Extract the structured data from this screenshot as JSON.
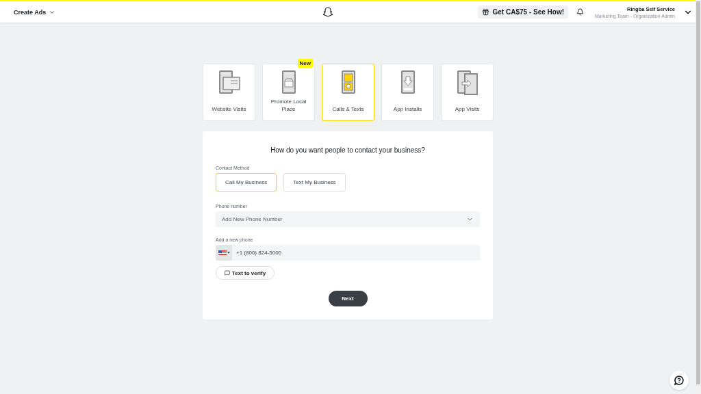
{
  "header": {
    "menu": "Create Ads",
    "promo": "Get CA$75 - See How!",
    "account_name": "Ringba Self Service",
    "account_role": "Marketing Team - Organization Admin"
  },
  "objectives": [
    {
      "label": "Website Visits",
      "selected": false
    },
    {
      "label": "Promote Local Place",
      "selected": false,
      "badge": "New"
    },
    {
      "label": "Calls & Texts",
      "selected": true
    },
    {
      "label": "App Installs",
      "selected": false
    },
    {
      "label": "App Visits",
      "selected": false
    }
  ],
  "form": {
    "question": "How do you want people to contact your business?",
    "contact_label": "Contact Method",
    "methods": [
      {
        "label": "Call My Business",
        "selected": true
      },
      {
        "label": "Text My Business",
        "selected": false
      }
    ],
    "phone_label": "Phone number",
    "phone_select": "Add New Phone Number",
    "new_phone_label": "Add a new phone",
    "new_phone_value": "+1 (800) 824-5000",
    "verify": "Text to verify",
    "next": "Next"
  }
}
